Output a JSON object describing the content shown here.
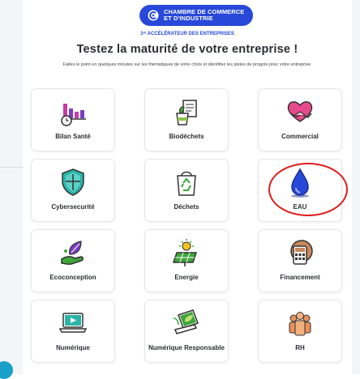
{
  "header": {
    "logo_line1": "CHAMBRE DE COMMERCE",
    "logo_line2": "ET D'INDUSTRIE",
    "tagline": "1ᵉʳ ACCÉLÉRATEUR DES ENTREPRISES",
    "title": "Testez la maturité de votre entreprise !",
    "subtitle": "Faites le point en quelques minutes sur les thématiques de votre choix et identifiez les pistes de progrès pour votre entreprise."
  },
  "colors": {
    "brand_blue": "#2748d8",
    "highlight_red": "#e11d1d",
    "card_border": "#e6e6ea"
  },
  "cards": [
    {
      "label": "Bilan Santé",
      "icon": "bar-chart-clock-icon"
    },
    {
      "label": "Biodéchets",
      "icon": "compost-bin-icon"
    },
    {
      "label": "Commercial",
      "icon": "handshake-heart-icon"
    },
    {
      "label": "Cybersecurité",
      "icon": "shield-icon"
    },
    {
      "label": "Déchets",
      "icon": "recycle-bag-icon"
    },
    {
      "label": "EAU",
      "icon": "water-drop-icon"
    },
    {
      "label": "Ecoconception",
      "icon": "hand-leaf-icon"
    },
    {
      "label": "Energie",
      "icon": "solar-panel-icon"
    },
    {
      "label": "Financement",
      "icon": "calculator-coin-icon"
    },
    {
      "label": "Numérique",
      "icon": "laptop-play-icon"
    },
    {
      "label": "Numérique Responsable",
      "icon": "eco-laptop-icon"
    },
    {
      "label": "RH",
      "icon": "people-group-icon"
    }
  ]
}
